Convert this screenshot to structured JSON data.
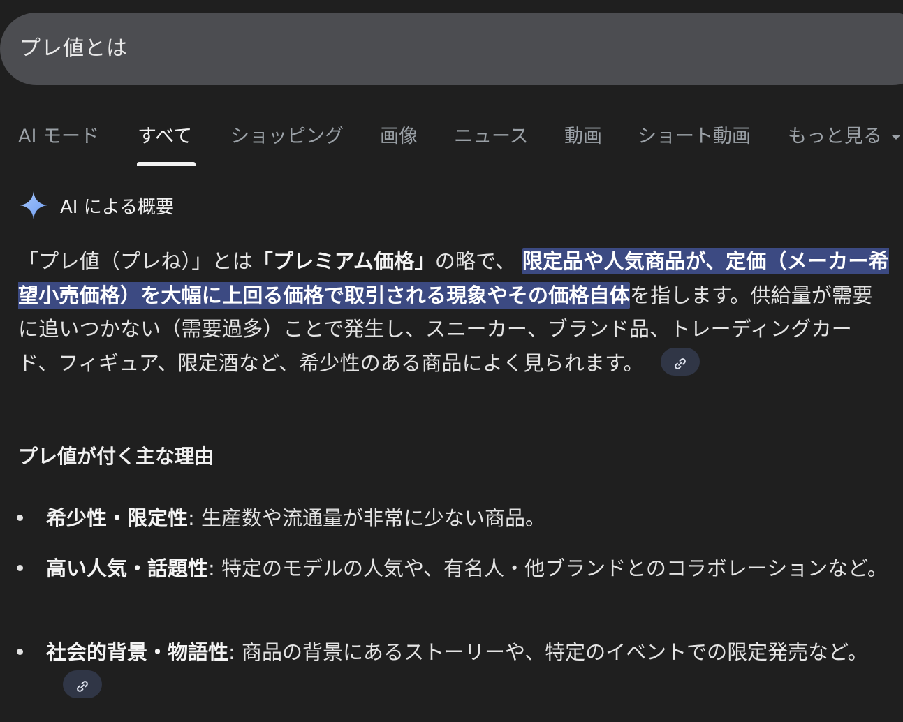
{
  "search": {
    "query": "プレ値とは"
  },
  "tabs": [
    {
      "label": "AI モード"
    },
    {
      "label": "すべて"
    },
    {
      "label": "ショッピング"
    },
    {
      "label": "画像"
    },
    {
      "label": "ニュース"
    },
    {
      "label": "動画"
    },
    {
      "label": "ショート動画"
    },
    {
      "label": "もっと見る"
    }
  ],
  "overview": {
    "title": "AI による概要",
    "p1": "「プレ値（プレね）」とは",
    "p2": "「プレミアム価格」",
    "p3": "の略で、",
    "highlight": "限定品や人気商品が、定価（メーカー希望小売価格）を大幅に上回る価格で取引される現象やその価格自体",
    "p4": "を指します。供給量が需要に追いつかない（需要過多）ことで発生し、スニーカー、ブランド品、トレーディングカード、フィギュア、限定酒など、希少性のある商品によく見られます。"
  },
  "reasons": {
    "title": "プレ値が付く主な理由",
    "items": [
      {
        "term": "希少性・限定性",
        "desc": ": 生産数や流通量が非常に少ない商品。"
      },
      {
        "term": "高い人気・話題性",
        "desc": ": 特定のモデルの人気や、有名人・他ブランドとのコラボレーションなど。"
      },
      {
        "term": "社会的背景・物語性",
        "desc": ": 商品の背景にあるストーリーや、特定のイベントでの限定発売など。"
      }
    ]
  },
  "icons": {
    "sparkle": "sparkle-icon",
    "link": "link-icon"
  },
  "colors": {
    "background": "#1f1f1f",
    "search_bar": "#4c4d51",
    "highlight": "#3c4a82",
    "chip": "#303646",
    "sparkle": "#8ab4f8"
  }
}
